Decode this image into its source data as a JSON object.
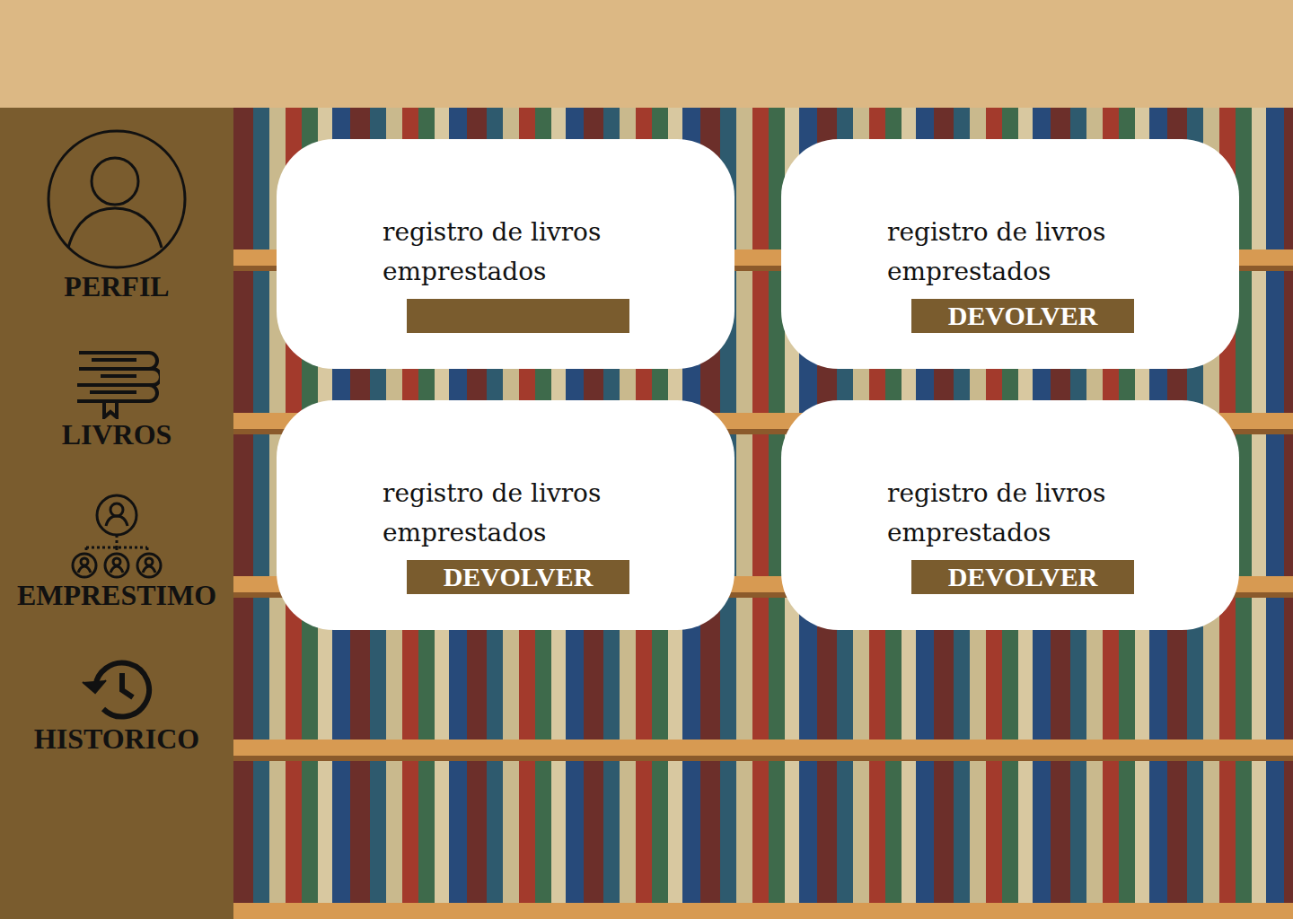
{
  "sidebar": {
    "items": [
      {
        "label": "PERFIL",
        "kind": "profile"
      },
      {
        "label": "LIVROS",
        "kind": "books"
      },
      {
        "label": "EMPRESTIMO",
        "kind": "loan"
      },
      {
        "label": "HISTORICO",
        "kind": "history"
      }
    ]
  },
  "cards": [
    {
      "lines": [
        "registro de livros",
        "emprestados"
      ],
      "button": ""
    },
    {
      "lines": [
        "registro de livros",
        "emprestados"
      ],
      "button": "DEVOLVER"
    },
    {
      "lines": [
        "registro de livros",
        "emprestados"
      ],
      "button": "DEVOLVER"
    },
    {
      "lines": [
        "registro de livros",
        "emprestados"
      ],
      "button": "DEVOLVER"
    }
  ]
}
